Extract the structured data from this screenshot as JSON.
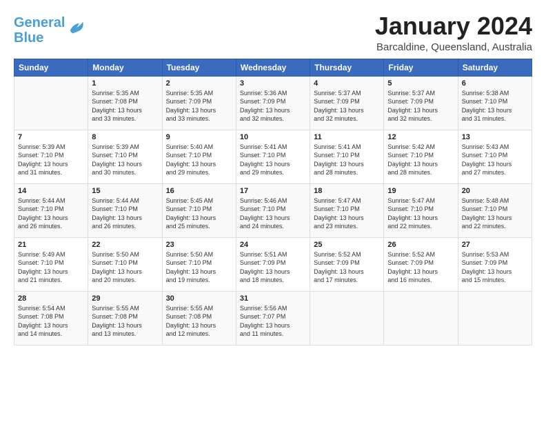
{
  "logo": {
    "line1": "General",
    "line2": "Blue"
  },
  "title": "January 2024",
  "subtitle": "Barcaldine, Queensland, Australia",
  "days_of_week": [
    "Sunday",
    "Monday",
    "Tuesday",
    "Wednesday",
    "Thursday",
    "Friday",
    "Saturday"
  ],
  "weeks": [
    [
      {
        "day": "",
        "info": ""
      },
      {
        "day": "1",
        "info": "Sunrise: 5:35 AM\nSunset: 7:08 PM\nDaylight: 13 hours\nand 33 minutes."
      },
      {
        "day": "2",
        "info": "Sunrise: 5:35 AM\nSunset: 7:09 PM\nDaylight: 13 hours\nand 33 minutes."
      },
      {
        "day": "3",
        "info": "Sunrise: 5:36 AM\nSunset: 7:09 PM\nDaylight: 13 hours\nand 32 minutes."
      },
      {
        "day": "4",
        "info": "Sunrise: 5:37 AM\nSunset: 7:09 PM\nDaylight: 13 hours\nand 32 minutes."
      },
      {
        "day": "5",
        "info": "Sunrise: 5:37 AM\nSunset: 7:09 PM\nDaylight: 13 hours\nand 32 minutes."
      },
      {
        "day": "6",
        "info": "Sunrise: 5:38 AM\nSunset: 7:10 PM\nDaylight: 13 hours\nand 31 minutes."
      }
    ],
    [
      {
        "day": "7",
        "info": "Sunrise: 5:39 AM\nSunset: 7:10 PM\nDaylight: 13 hours\nand 31 minutes."
      },
      {
        "day": "8",
        "info": "Sunrise: 5:39 AM\nSunset: 7:10 PM\nDaylight: 13 hours\nand 30 minutes."
      },
      {
        "day": "9",
        "info": "Sunrise: 5:40 AM\nSunset: 7:10 PM\nDaylight: 13 hours\nand 29 minutes."
      },
      {
        "day": "10",
        "info": "Sunrise: 5:41 AM\nSunset: 7:10 PM\nDaylight: 13 hours\nand 29 minutes."
      },
      {
        "day": "11",
        "info": "Sunrise: 5:41 AM\nSunset: 7:10 PM\nDaylight: 13 hours\nand 28 minutes."
      },
      {
        "day": "12",
        "info": "Sunrise: 5:42 AM\nSunset: 7:10 PM\nDaylight: 13 hours\nand 28 minutes."
      },
      {
        "day": "13",
        "info": "Sunrise: 5:43 AM\nSunset: 7:10 PM\nDaylight: 13 hours\nand 27 minutes."
      }
    ],
    [
      {
        "day": "14",
        "info": "Sunrise: 5:44 AM\nSunset: 7:10 PM\nDaylight: 13 hours\nand 26 minutes."
      },
      {
        "day": "15",
        "info": "Sunrise: 5:44 AM\nSunset: 7:10 PM\nDaylight: 13 hours\nand 26 minutes."
      },
      {
        "day": "16",
        "info": "Sunrise: 5:45 AM\nSunset: 7:10 PM\nDaylight: 13 hours\nand 25 minutes."
      },
      {
        "day": "17",
        "info": "Sunrise: 5:46 AM\nSunset: 7:10 PM\nDaylight: 13 hours\nand 24 minutes."
      },
      {
        "day": "18",
        "info": "Sunrise: 5:47 AM\nSunset: 7:10 PM\nDaylight: 13 hours\nand 23 minutes."
      },
      {
        "day": "19",
        "info": "Sunrise: 5:47 AM\nSunset: 7:10 PM\nDaylight: 13 hours\nand 22 minutes."
      },
      {
        "day": "20",
        "info": "Sunrise: 5:48 AM\nSunset: 7:10 PM\nDaylight: 13 hours\nand 22 minutes."
      }
    ],
    [
      {
        "day": "21",
        "info": "Sunrise: 5:49 AM\nSunset: 7:10 PM\nDaylight: 13 hours\nand 21 minutes."
      },
      {
        "day": "22",
        "info": "Sunrise: 5:50 AM\nSunset: 7:10 PM\nDaylight: 13 hours\nand 20 minutes."
      },
      {
        "day": "23",
        "info": "Sunrise: 5:50 AM\nSunset: 7:10 PM\nDaylight: 13 hours\nand 19 minutes."
      },
      {
        "day": "24",
        "info": "Sunrise: 5:51 AM\nSunset: 7:09 PM\nDaylight: 13 hours\nand 18 minutes."
      },
      {
        "day": "25",
        "info": "Sunrise: 5:52 AM\nSunset: 7:09 PM\nDaylight: 13 hours\nand 17 minutes."
      },
      {
        "day": "26",
        "info": "Sunrise: 5:52 AM\nSunset: 7:09 PM\nDaylight: 13 hours\nand 16 minutes."
      },
      {
        "day": "27",
        "info": "Sunrise: 5:53 AM\nSunset: 7:09 PM\nDaylight: 13 hours\nand 15 minutes."
      }
    ],
    [
      {
        "day": "28",
        "info": "Sunrise: 5:54 AM\nSunset: 7:08 PM\nDaylight: 13 hours\nand 14 minutes."
      },
      {
        "day": "29",
        "info": "Sunrise: 5:55 AM\nSunset: 7:08 PM\nDaylight: 13 hours\nand 13 minutes."
      },
      {
        "day": "30",
        "info": "Sunrise: 5:55 AM\nSunset: 7:08 PM\nDaylight: 13 hours\nand 12 minutes."
      },
      {
        "day": "31",
        "info": "Sunrise: 5:56 AM\nSunset: 7:07 PM\nDaylight: 13 hours\nand 11 minutes."
      },
      {
        "day": "",
        "info": ""
      },
      {
        "day": "",
        "info": ""
      },
      {
        "day": "",
        "info": ""
      }
    ]
  ]
}
